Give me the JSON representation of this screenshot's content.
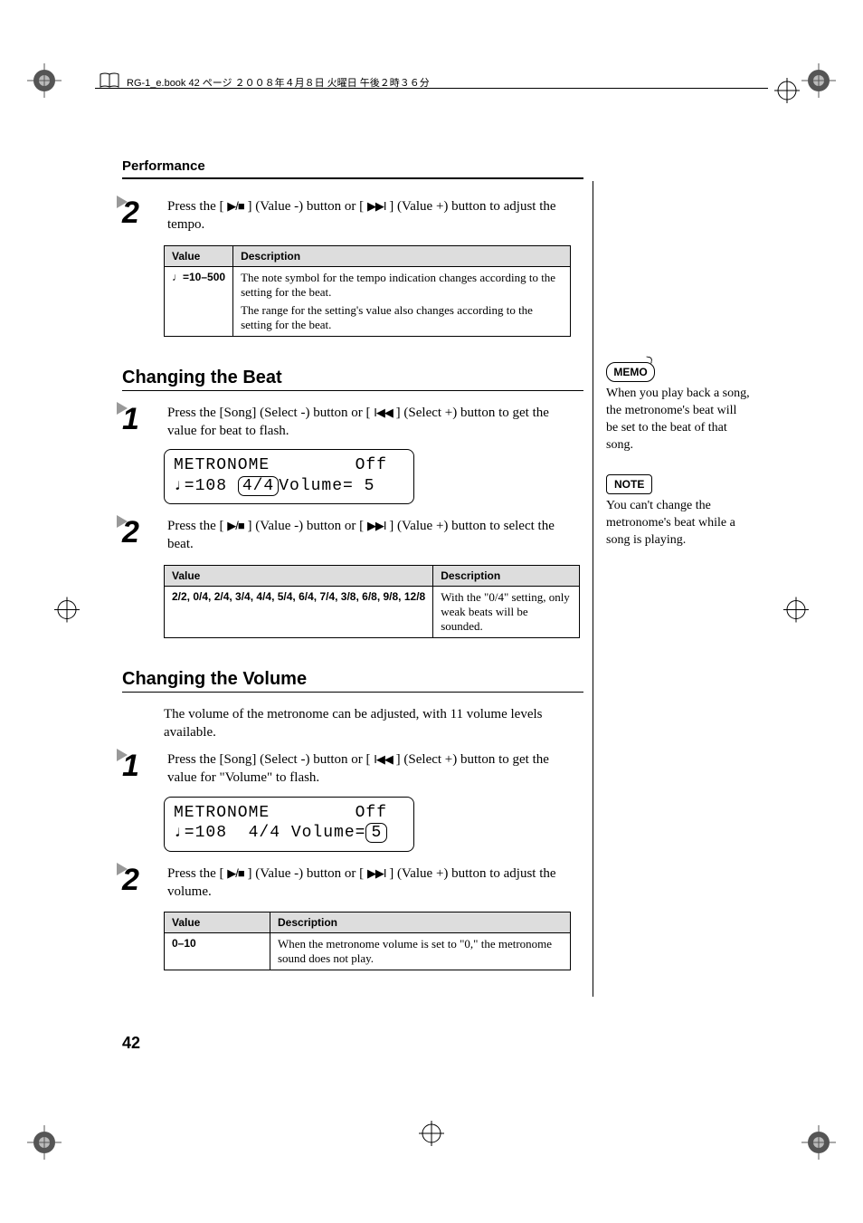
{
  "header": {
    "print_line": "RG-1_e.book 42 ページ ２００８年４月８日 火曜日 午後２時３６分",
    "section_top": "Performance"
  },
  "step2a": {
    "num": "2",
    "instr_a": "Press the [ ",
    "glyph_a": "▶/■",
    "instr_b": " ] (Value -) button or [ ",
    "glyph_b": "▶▶I",
    "instr_c": " ] (Value +) button to adjust the tempo."
  },
  "table1": {
    "h1": "Value",
    "h2": "Description",
    "val_prefix": "♩",
    "val": "=10–500",
    "desc_a": "The note symbol for the tempo indication changes according to the setting for the beat.",
    "desc_b": "The range for the setting's value also changes according to the setting for the beat."
  },
  "sec_beat": {
    "title": "Changing the Beat"
  },
  "step1b": {
    "num": "1",
    "instr_a": "Press the [Song] (Select -) button or [ ",
    "glyph": "I◀◀",
    "instr_b": " ] (Select +) button to get the value for beat to flash."
  },
  "lcd1": {
    "row1": "METRONOME        Off",
    "row2a": "♩=108 ",
    "row2_circ": "4/4",
    "row2b": "Volume= 5"
  },
  "step2b": {
    "num": "2",
    "instr_a": "Press the [ ",
    "glyph_a": "▶/■",
    "instr_b": " ] (Value -) button or [ ",
    "glyph_b": "▶▶I",
    "instr_c": " ] (Value +) button to select the beat."
  },
  "table2": {
    "h1": "Value",
    "h2": "Description",
    "val": "2/2, 0/4, 2/4, 3/4, 4/4, 5/4, 6/4, 7/4, 3/8, 6/8, 9/8, 12/8",
    "desc": "With the \"0/4\" setting, only weak beats will be sounded."
  },
  "sec_vol": {
    "title": "Changing the Volume",
    "para": "The volume of the metronome can be adjusted, with 11 volume levels available."
  },
  "step1c": {
    "num": "1",
    "instr_a": "Press the [Song] (Select -) button or [ ",
    "glyph": "I◀◀",
    "instr_b": " ] (Select +) button to get the value for \"Volume\" to flash."
  },
  "lcd2": {
    "row1": "METRONOME        Off",
    "row2a": "♩=108  4/4 Volume=",
    "row2_circ": "5"
  },
  "step2c": {
    "num": "2",
    "instr_a": "Press the [ ",
    "glyph_a": "▶/■",
    "instr_b": " ] (Value -) button or [ ",
    "glyph_b": "▶▶I",
    "instr_c": " ] (Value +) button to adjust the volume."
  },
  "table3": {
    "h1": "Value",
    "h2": "Description",
    "val": "0–10",
    "desc": "When the metronome volume is set to \"0,\" the metronome sound does not play."
  },
  "side": {
    "memo_label": "MEMO",
    "memo_text": "When you play back a song, the metronome's beat will be set to the beat of that song.",
    "note_label": "NOTE",
    "note_text": "You can't change the metronome's beat while a song is playing."
  },
  "page_number": "42"
}
